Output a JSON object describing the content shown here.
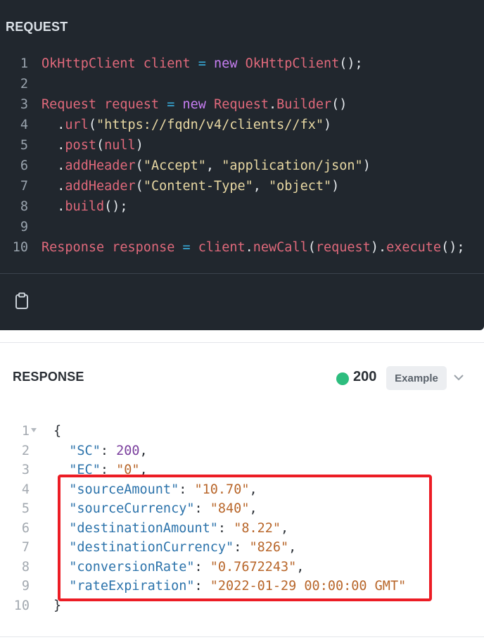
{
  "request": {
    "header": "REQUEST",
    "lines": [
      {
        "n": "1",
        "parts": [
          {
            "t": "OkHttpClient",
            "c": "type"
          },
          {
            "t": " ",
            "c": "pun"
          },
          {
            "t": "client",
            "c": "var"
          },
          {
            "t": " ",
            "c": "pun"
          },
          {
            "t": "=",
            "c": "op"
          },
          {
            "t": " ",
            "c": "pun"
          },
          {
            "t": "new",
            "c": "kw"
          },
          {
            "t": " ",
            "c": "pun"
          },
          {
            "t": "OkHttpClient",
            "c": "type"
          },
          {
            "t": "();",
            "c": "pun"
          }
        ]
      },
      {
        "n": "2",
        "parts": []
      },
      {
        "n": "3",
        "parts": [
          {
            "t": "Request",
            "c": "type"
          },
          {
            "t": " ",
            "c": "pun"
          },
          {
            "t": "request",
            "c": "var"
          },
          {
            "t": " ",
            "c": "pun"
          },
          {
            "t": "=",
            "c": "op"
          },
          {
            "t": " ",
            "c": "pun"
          },
          {
            "t": "new",
            "c": "kw"
          },
          {
            "t": " ",
            "c": "pun"
          },
          {
            "t": "Request",
            "c": "type"
          },
          {
            "t": ".",
            "c": "dot"
          },
          {
            "t": "Builder",
            "c": "fn"
          },
          {
            "t": "()",
            "c": "pun"
          }
        ]
      },
      {
        "n": "4",
        "parts": [
          {
            "t": "  .",
            "c": "dot"
          },
          {
            "t": "url",
            "c": "fn"
          },
          {
            "t": "(",
            "c": "pun"
          },
          {
            "t": "\"https://fqdn/v4/clients//fx\"",
            "c": "str"
          },
          {
            "t": ")",
            "c": "pun"
          }
        ]
      },
      {
        "n": "5",
        "parts": [
          {
            "t": "  .",
            "c": "dot"
          },
          {
            "t": "post",
            "c": "fn"
          },
          {
            "t": "(",
            "c": "pun"
          },
          {
            "t": "null",
            "c": "type"
          },
          {
            "t": ")",
            "c": "pun"
          }
        ]
      },
      {
        "n": "6",
        "parts": [
          {
            "t": "  .",
            "c": "dot"
          },
          {
            "t": "addHeader",
            "c": "fn"
          },
          {
            "t": "(",
            "c": "pun"
          },
          {
            "t": "\"Accept\"",
            "c": "str"
          },
          {
            "t": ", ",
            "c": "pun"
          },
          {
            "t": "\"application/json\"",
            "c": "str"
          },
          {
            "t": ")",
            "c": "pun"
          }
        ]
      },
      {
        "n": "7",
        "parts": [
          {
            "t": "  .",
            "c": "dot"
          },
          {
            "t": "addHeader",
            "c": "fn"
          },
          {
            "t": "(",
            "c": "pun"
          },
          {
            "t": "\"Content-Type\"",
            "c": "str"
          },
          {
            "t": ", ",
            "c": "pun"
          },
          {
            "t": "\"object\"",
            "c": "str"
          },
          {
            "t": ")",
            "c": "pun"
          }
        ]
      },
      {
        "n": "8",
        "parts": [
          {
            "t": "  .",
            "c": "dot"
          },
          {
            "t": "build",
            "c": "fn"
          },
          {
            "t": "();",
            "c": "pun"
          }
        ]
      },
      {
        "n": "9",
        "parts": []
      },
      {
        "n": "10",
        "parts": [
          {
            "t": "Response",
            "c": "type"
          },
          {
            "t": " ",
            "c": "pun"
          },
          {
            "t": "response",
            "c": "var"
          },
          {
            "t": " ",
            "c": "pun"
          },
          {
            "t": "=",
            "c": "op"
          },
          {
            "t": " ",
            "c": "pun"
          },
          {
            "t": "client",
            "c": "var"
          },
          {
            "t": ".",
            "c": "dot"
          },
          {
            "t": "newCall",
            "c": "fn"
          },
          {
            "t": "(",
            "c": "pun"
          },
          {
            "t": "request",
            "c": "var"
          },
          {
            "t": ").",
            "c": "pun"
          },
          {
            "t": "execute",
            "c": "fn"
          },
          {
            "t": "();",
            "c": "pun"
          }
        ]
      }
    ]
  },
  "response": {
    "header": "RESPONSE",
    "status_code": "200",
    "status_color": "#2dbd7e",
    "example_label": "Example",
    "lines": [
      {
        "n": "1",
        "fold": true,
        "parts": [
          {
            "t": "{",
            "c": "pun"
          }
        ]
      },
      {
        "n": "2",
        "parts": [
          {
            "t": "  \"SC\"",
            "c": "key"
          },
          {
            "t": ": ",
            "c": "pun"
          },
          {
            "t": "200",
            "c": "num"
          },
          {
            "t": ",",
            "c": "pun"
          }
        ]
      },
      {
        "n": "3",
        "parts": [
          {
            "t": "  \"EC\"",
            "c": "key"
          },
          {
            "t": ": ",
            "c": "pun"
          },
          {
            "t": "\"0\"",
            "c": "str"
          },
          {
            "t": ",",
            "c": "pun"
          }
        ]
      },
      {
        "n": "4",
        "parts": [
          {
            "t": "  \"sourceAmount\"",
            "c": "key"
          },
          {
            "t": ": ",
            "c": "pun"
          },
          {
            "t": "\"10.70\"",
            "c": "str"
          },
          {
            "t": ",",
            "c": "pun"
          }
        ]
      },
      {
        "n": "5",
        "parts": [
          {
            "t": "  \"sourceCurrency\"",
            "c": "key"
          },
          {
            "t": ": ",
            "c": "pun"
          },
          {
            "t": "\"840\"",
            "c": "str"
          },
          {
            "t": ",",
            "c": "pun"
          }
        ]
      },
      {
        "n": "6",
        "parts": [
          {
            "t": "  \"destinationAmount\"",
            "c": "key"
          },
          {
            "t": ": ",
            "c": "pun"
          },
          {
            "t": "\"8.22\"",
            "c": "str"
          },
          {
            "t": ",",
            "c": "pun"
          }
        ]
      },
      {
        "n": "7",
        "parts": [
          {
            "t": "  \"destinationCurrency\"",
            "c": "key"
          },
          {
            "t": ": ",
            "c": "pun"
          },
          {
            "t": "\"826\"",
            "c": "str"
          },
          {
            "t": ",",
            "c": "pun"
          }
        ]
      },
      {
        "n": "8",
        "parts": [
          {
            "t": "  \"conversionRate\"",
            "c": "key"
          },
          {
            "t": ": ",
            "c": "pun"
          },
          {
            "t": "\"0.7672243\"",
            "c": "str"
          },
          {
            "t": ",",
            "c": "pun"
          }
        ]
      },
      {
        "n": "9",
        "parts": [
          {
            "t": "  \"rateExpiration\"",
            "c": "key"
          },
          {
            "t": ": ",
            "c": "pun"
          },
          {
            "t": "\"2022-01-29 00:00:00 GMT\"",
            "c": "str"
          }
        ]
      },
      {
        "n": "10",
        "parts": [
          {
            "t": "}",
            "c": "pun"
          }
        ]
      }
    ]
  },
  "annotation": {
    "highlight_color": "#ec1c24"
  }
}
